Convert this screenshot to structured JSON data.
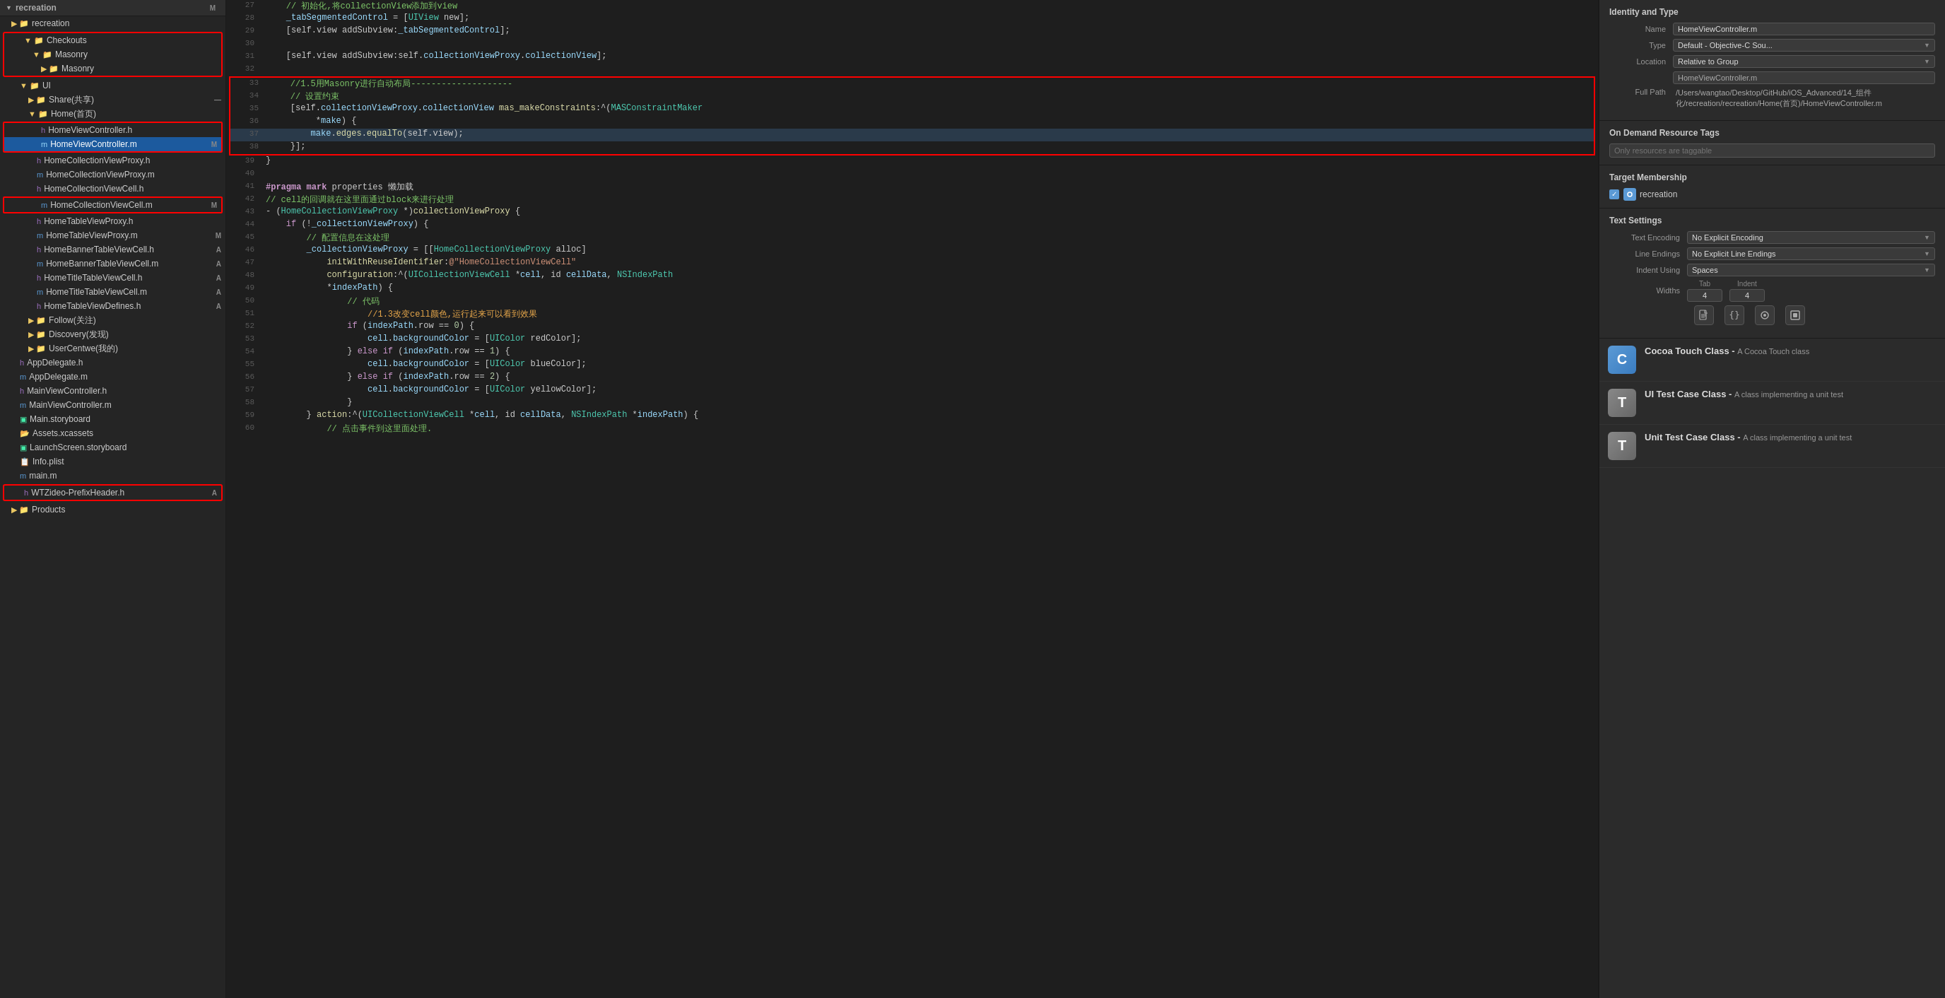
{
  "app": {
    "title": "recreation"
  },
  "sidebar": {
    "root_label": "recreation",
    "badge": "M",
    "items": [
      {
        "id": "recreation-child",
        "label": "recreation",
        "level": 1,
        "type": "folder",
        "badge": ""
      },
      {
        "id": "checkouts",
        "label": "Checkouts",
        "level": 2,
        "type": "folder",
        "badge": "",
        "expanded": true
      },
      {
        "id": "masonry-parent",
        "label": "Masonry",
        "level": 3,
        "type": "folder",
        "badge": "",
        "expanded": true
      },
      {
        "id": "masonry-child",
        "label": "Masonry",
        "level": 4,
        "type": "folder",
        "badge": ""
      },
      {
        "id": "ui",
        "label": "UI",
        "level": 2,
        "type": "folder",
        "badge": "",
        "expanded": true
      },
      {
        "id": "share",
        "label": "Share(共享)",
        "level": 3,
        "type": "folder",
        "badge": "—"
      },
      {
        "id": "home",
        "label": "Home(首页)",
        "level": 3,
        "type": "folder",
        "badge": "",
        "expanded": true
      },
      {
        "id": "HomeViewController.h",
        "label": "HomeViewController.h",
        "level": 4,
        "type": "h",
        "badge": "",
        "outlined": true
      },
      {
        "id": "HomeViewController.m",
        "label": "HomeViewController.m",
        "level": 4,
        "type": "m",
        "badge": "M",
        "selected": true,
        "outlined": true
      },
      {
        "id": "HomeCollectionViewProxy.h",
        "label": "HomeCollectionViewProxy.h",
        "level": 4,
        "type": "h",
        "badge": ""
      },
      {
        "id": "HomeCollectionViewProxy.m",
        "label": "HomeCollectionViewProxy.m",
        "level": 4,
        "type": "m",
        "badge": ""
      },
      {
        "id": "HomeCollectionViewCell.h",
        "label": "HomeCollectionViewCell.h",
        "level": 4,
        "type": "h",
        "badge": ""
      },
      {
        "id": "HomeCollectionViewCell.m",
        "label": "HomeCollectionViewCell.m",
        "level": 4,
        "type": "m",
        "badge": "M",
        "outlined": true
      },
      {
        "id": "HomeTableViewProxy.h",
        "label": "HomeTableViewProxy.h",
        "level": 4,
        "type": "h",
        "badge": ""
      },
      {
        "id": "HomeTableViewProxy.m",
        "label": "HomeTableViewProxy.m",
        "level": 4,
        "type": "m",
        "badge": "M"
      },
      {
        "id": "HomeBannerTableViewCell.h",
        "label": "HomeBannerTableViewCell.h",
        "level": 4,
        "type": "h",
        "badge": "A"
      },
      {
        "id": "HomeBannerTableViewCell.m",
        "label": "HomeBannerTableViewCell.m",
        "level": 4,
        "type": "m",
        "badge": "A"
      },
      {
        "id": "HomeTitleTableViewCell.h",
        "label": "HomeTitleTableViewCell.h",
        "level": 4,
        "type": "h",
        "badge": "A"
      },
      {
        "id": "HomeTitleTableViewCell.m",
        "label": "HomeTitleTableViewCell.m",
        "level": 4,
        "type": "m",
        "badge": "A"
      },
      {
        "id": "HomeTableViewDefines.h",
        "label": "HomeTableViewDefines.h",
        "level": 4,
        "type": "h",
        "badge": "A"
      },
      {
        "id": "follow",
        "label": "Follow(关注)",
        "level": 3,
        "type": "folder",
        "badge": ""
      },
      {
        "id": "discovery",
        "label": "Discovery(发现)",
        "level": 3,
        "type": "folder",
        "badge": ""
      },
      {
        "id": "usercentwe",
        "label": "UserCentwe(我的)",
        "level": 3,
        "type": "folder",
        "badge": ""
      },
      {
        "id": "AppDelegate.h",
        "label": "AppDelegate.h",
        "level": 2,
        "type": "h",
        "badge": ""
      },
      {
        "id": "AppDelegate.m",
        "label": "AppDelegate.m",
        "level": 2,
        "type": "m",
        "badge": ""
      },
      {
        "id": "MainViewController.h",
        "label": "MainViewController.h",
        "level": 2,
        "type": "h",
        "badge": ""
      },
      {
        "id": "MainViewController.m",
        "label": "MainViewController.m",
        "level": 2,
        "type": "m",
        "badge": ""
      },
      {
        "id": "Main.storyboard",
        "label": "Main.storyboard",
        "level": 2,
        "type": "storyboard",
        "badge": ""
      },
      {
        "id": "Assets.xcassets",
        "label": "Assets.xcassets",
        "level": 2,
        "type": "xcassets",
        "badge": ""
      },
      {
        "id": "LaunchScreen.storyboard",
        "label": "LaunchScreen.storyboard",
        "level": 2,
        "type": "storyboard",
        "badge": ""
      },
      {
        "id": "Info.plist",
        "label": "Info.plist",
        "level": 2,
        "type": "plist",
        "badge": ""
      },
      {
        "id": "main.m",
        "label": "main.m",
        "level": 2,
        "type": "m",
        "badge": ""
      },
      {
        "id": "WTZideo-PrefixHeader.h",
        "label": "WTZideo-PrefixHeader.h",
        "level": 2,
        "type": "h",
        "badge": "A",
        "outlined": true
      },
      {
        "id": "Products",
        "label": "Products",
        "level": 1,
        "type": "folder",
        "badge": ""
      }
    ]
  },
  "code": {
    "lines": [
      {
        "num": 27,
        "content": "    // 初始化,将collectionView添加到view",
        "type": "comment"
      },
      {
        "num": 28,
        "content": "    _tabSegmentedControl = [UIView new];",
        "type": "code"
      },
      {
        "num": 29,
        "content": "    [self.view addSubview:_tabSegmentedControl];",
        "type": "code"
      },
      {
        "num": 30,
        "content": "",
        "type": "blank"
      },
      {
        "num": 31,
        "content": "    [self.view addSubview:self.collectionViewProxy.collectionView];",
        "type": "code"
      },
      {
        "num": 32,
        "content": "",
        "type": "blank"
      },
      {
        "num": 33,
        "content": "    //1.5用Masonry进行自动布局--------------------",
        "type": "comment-red"
      },
      {
        "num": 34,
        "content": "    // 设置约束",
        "type": "comment-red"
      },
      {
        "num": 35,
        "content": "    [self.collectionViewProxy.collectionView mas_makeConstraints:^(MASConstraintMaker",
        "type": "code-red"
      },
      {
        "num": 36,
        "content": "         *make) {",
        "type": "code-red"
      },
      {
        "num": 37,
        "content": "        make.edges.equalTo(self.view);",
        "type": "code-red-hl"
      },
      {
        "num": 38,
        "content": "    }];",
        "type": "code-red"
      },
      {
        "num": 39,
        "content": "}",
        "type": "code"
      },
      {
        "num": 40,
        "content": "",
        "type": "blank"
      },
      {
        "num": 41,
        "content": "#pragma mark properties 懒加载",
        "type": "pragma"
      },
      {
        "num": 42,
        "content": "// cell的回调就在这里面通过block来进行处理",
        "type": "comment"
      },
      {
        "num": 43,
        "content": "- (HomeCollectionViewProxy *)collectionViewProxy {",
        "type": "code"
      },
      {
        "num": 44,
        "content": "    if (!_collectionViewProxy) {",
        "type": "code"
      },
      {
        "num": 45,
        "content": "        // 配置信息在这处理",
        "type": "comment-green"
      },
      {
        "num": 46,
        "content": "        _collectionViewProxy = [[HomeCollectionViewProxy alloc]",
        "type": "code"
      },
      {
        "num": 47,
        "content": "            initWithReuseIdentifier:@\"HomeCollectionViewCell\"",
        "type": "code"
      },
      {
        "num": 48,
        "content": "            configuration:^(UICollectionViewCell *cell, id cellData, NSIndexPath",
        "type": "code"
      },
      {
        "num": 49,
        "content": "            *indexPath) {",
        "type": "code"
      },
      {
        "num": 50,
        "content": "                // 代码",
        "type": "comment-green"
      },
      {
        "num": 51,
        "content": "                //1.3改变cell颜色,运行起来可以看到效果",
        "type": "comment-orange"
      },
      {
        "num": 52,
        "content": "                if (indexPath.row == 0) {",
        "type": "code"
      },
      {
        "num": 53,
        "content": "                    cell.backgroundColor = [UIColor redColor];",
        "type": "code"
      },
      {
        "num": 54,
        "content": "                } else if (indexPath.row == 1) {",
        "type": "code"
      },
      {
        "num": 55,
        "content": "                    cell.backgroundColor = [UIColor blueColor];",
        "type": "code"
      },
      {
        "num": 56,
        "content": "                } else if (indexPath.row == 2) {",
        "type": "code"
      },
      {
        "num": 57,
        "content": "                    cell.backgroundColor = [UIColor yellowColor];",
        "type": "code"
      },
      {
        "num": 58,
        "content": "                }",
        "type": "code"
      },
      {
        "num": 59,
        "content": "        } action:^(UICollectionViewCell *cell, id cellData, NSIndexPath *indexPath) {",
        "type": "code"
      },
      {
        "num": 60,
        "content": "            // 点击事件到这里面处理.",
        "type": "comment-green"
      }
    ]
  },
  "right_panel": {
    "identity_type": {
      "title": "Identity and Type",
      "name_label": "Name",
      "name_value": "HomeViewController.m",
      "type_label": "Type",
      "type_value": "Default - Objective-C Sou...",
      "location_label": "Location",
      "location_value": "Relative to Group",
      "full_path_label": "Full Path",
      "full_path_value": "/Users/wangtao/Desktop/GitHub/iOS_Advanced/14_组件化/recreation/recreation/Home(首页)/HomeViewController.m"
    },
    "on_demand": {
      "title": "On Demand Resource Tags",
      "placeholder": "Only resources are taggable"
    },
    "target_membership": {
      "title": "Target Membership",
      "items": [
        {
          "label": "recreation",
          "checked": true
        }
      ]
    },
    "text_settings": {
      "title": "Text Settings",
      "encoding_label": "Text Encoding",
      "encoding_value": "No Explicit Encoding",
      "line_endings_label": "Line Endings",
      "line_endings_value": "No Explicit Line Endings",
      "indent_label": "Indent Using",
      "indent_value": "Spaces",
      "widths_label": "Widths",
      "tab_label": "Tab",
      "tab_value": "4",
      "indent_field_label": "Indent",
      "indent_field_value": "4"
    },
    "icons": [
      {
        "name": "file-icon",
        "symbol": "📄"
      },
      {
        "name": "braces-icon",
        "symbol": "{}"
      },
      {
        "name": "circle-icon",
        "symbol": "◎"
      },
      {
        "name": "square-icon",
        "symbol": "▣"
      }
    ],
    "templates": [
      {
        "id": "cocoa-touch-class",
        "icon_letter": "C",
        "icon_color": "#5b9ad5",
        "name": "Cocoa Touch Class",
        "desc": "A Cocoa Touch class"
      },
      {
        "id": "ui-test-case-class",
        "icon_letter": "T",
        "icon_color": "#777",
        "name": "UI Test Case Class",
        "desc": "A class implementing a unit test"
      },
      {
        "id": "unit-test-case-class",
        "icon_letter": "T",
        "icon_color": "#777",
        "name": "Unit Test Case Class",
        "desc": "A class implementing a unit test"
      }
    ]
  }
}
